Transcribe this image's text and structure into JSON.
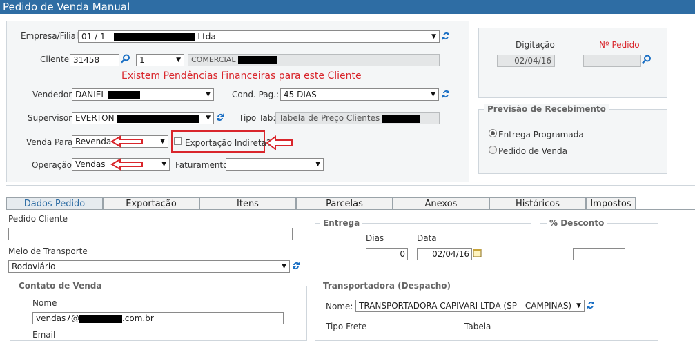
{
  "window": {
    "title": "Pedido de Venda Manual"
  },
  "header": {
    "empresa_label": "Empresa/Filial:",
    "empresa_value_prefix": "01 / 1 -",
    "empresa_value_suffix": "Ltda",
    "cliente_label": "Cliente:",
    "cliente_code": "31458",
    "cliente_loja": "1",
    "cliente_name": "COMERCIAL",
    "pendencia_msg": "Existem Pendências Financeiras para este Cliente",
    "vendedor_label": "Vendedor:",
    "vendedor_value": "DANIEL",
    "cond_pag_label": "Cond. Pag.:",
    "cond_pag_value": "45 DIAS",
    "supervisor_label": "Supervisor:",
    "supervisor_value": "EVERTON",
    "tipo_tab_label": "Tipo Tab:",
    "tipo_tab_value": "Tabela de Preço Clientes",
    "venda_para_label": "Venda Para:",
    "venda_para_value": "Revenda",
    "exportacao_indireta_label": "Exportação Indireta?",
    "operacao_label": "Operação:",
    "operacao_value": "Vendas",
    "faturamento_label": "Faturamento:",
    "faturamento_value": ""
  },
  "side": {
    "digitacao_label": "Digitação",
    "digitacao_value": "02/04/16",
    "n_pedido_label": "Nº Pedido",
    "n_pedido_value": "",
    "previsao_legend": "Previsão de Recebimento",
    "radio_entrega": "Entrega Programada",
    "radio_pedido": "Pedido de Venda"
  },
  "tabs": [
    "Dados Pedido",
    "Exportação",
    "Itens",
    "Parcelas",
    "Anexos",
    "Históricos",
    "Impostos"
  ],
  "form": {
    "pedido_cliente_label": "Pedido Cliente",
    "pedido_cliente_value": "",
    "meio_transporte_label": "Meio de Transporte",
    "meio_transporte_value": "Rodoviário",
    "contato_legend": "Contato de Venda",
    "nome_label": "Nome",
    "email_prefix": "vendas7@",
    "email_suffix": ".com.br",
    "email_label": "Email",
    "entrega_legend": "Entrega",
    "dias_label": "Dias",
    "dias_value": "0",
    "data_label": "Data",
    "data_value": "02/04/16",
    "desconto_legend": "% Desconto",
    "desconto_value": "",
    "transportadora_legend": "Transportadora (Despacho)",
    "transp_nome_label": "Nome:",
    "transp_nome_value": "TRANSPORTADORA CAPIVARI LTDA (SP - CAMPINAS)",
    "tipo_frete_label": "Tipo Frete",
    "tabela_label": "Tabela"
  },
  "colors": {
    "title_bg": "#2e6da4",
    "alert_red": "#d9262c"
  }
}
